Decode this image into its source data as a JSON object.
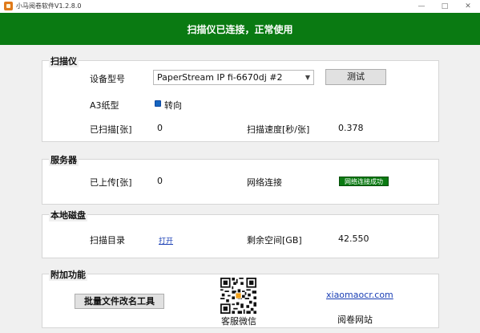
{
  "window": {
    "title": "小马阅卷软件V1.2.8.0",
    "minimize_glyph": "—",
    "maximize_glyph": "□",
    "close_glyph": "✕"
  },
  "banner": {
    "text": "扫描仪已连接，正常使用",
    "color": "#0a7a12"
  },
  "scanner": {
    "title": "扫描仪",
    "device_model_label": "设备型号",
    "device_model_value": "PaperStream IP fi-6670dj #2",
    "test_button": "测试",
    "a3_label": "A3纸型",
    "rotate_label": "转向",
    "scanned_label": "已扫描[张]",
    "scanned_value": "0",
    "speed_label": "扫描速度[秒/张]",
    "speed_value": "0.378"
  },
  "server": {
    "title": "服务器",
    "uploaded_label": "已上传[张]",
    "uploaded_value": "0",
    "network_label": "网络连接",
    "network_status": "网络连接成功"
  },
  "disk": {
    "title": "本地磁盘",
    "scan_dir_label": "扫描目录",
    "open_link": "打开",
    "free_space_label": "剩余空间[GB]",
    "free_space_value": "42.550"
  },
  "extra": {
    "title": "附加功能",
    "rename_button": "批量文件改名工具",
    "qr_caption": "客服微信",
    "website_link": "xiaomaocr.com",
    "website_caption": "阅卷网站"
  },
  "icons": {
    "app": "app-logo-icon",
    "qr": "qr-code-icon",
    "select_caret": "chevron-down-icon"
  }
}
